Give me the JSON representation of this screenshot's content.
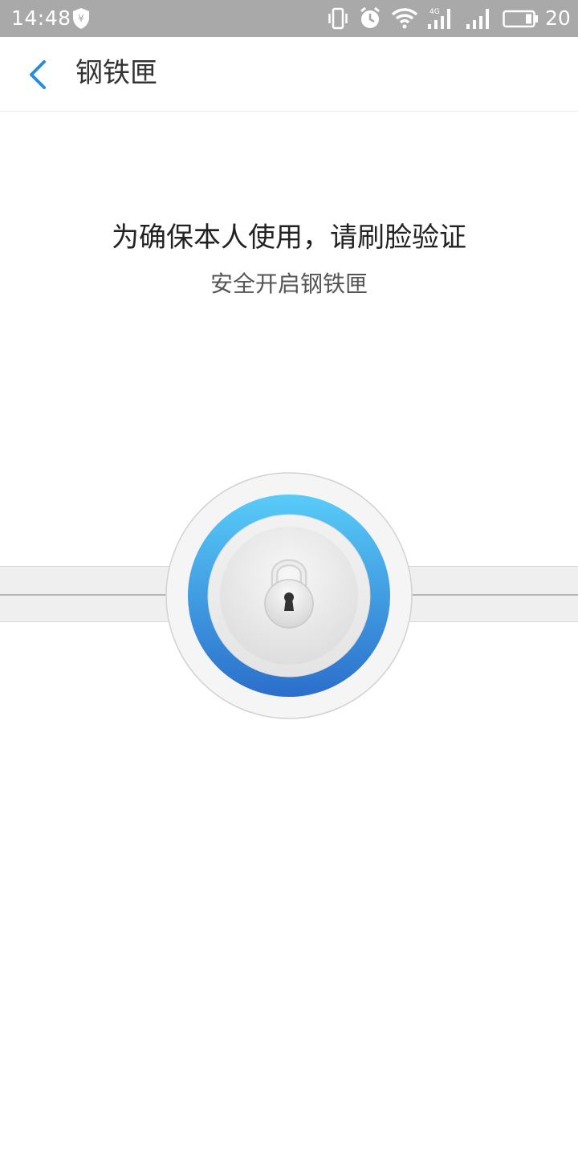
{
  "status_bar": {
    "time": "14:48",
    "battery_level": "20",
    "icons": [
      "shield-yen-icon",
      "vibrate-icon",
      "alarm-icon",
      "wifi-icon",
      "signal-4g-icon",
      "signal-icon",
      "battery-icon"
    ]
  },
  "header": {
    "title": "钢铁匣",
    "back_icon": "chevron-left-icon"
  },
  "main": {
    "prompt": "为确保本人使用，请刷脸验证",
    "subprompt": "安全开启钢铁匣",
    "lock_icon": "padlock-icon"
  },
  "colors": {
    "status_bar_bg": "#a9a9a9",
    "accent_blue": "#2a8ce0",
    "ring_top": "#58ccf8",
    "ring_bottom": "#2b6ecb"
  }
}
